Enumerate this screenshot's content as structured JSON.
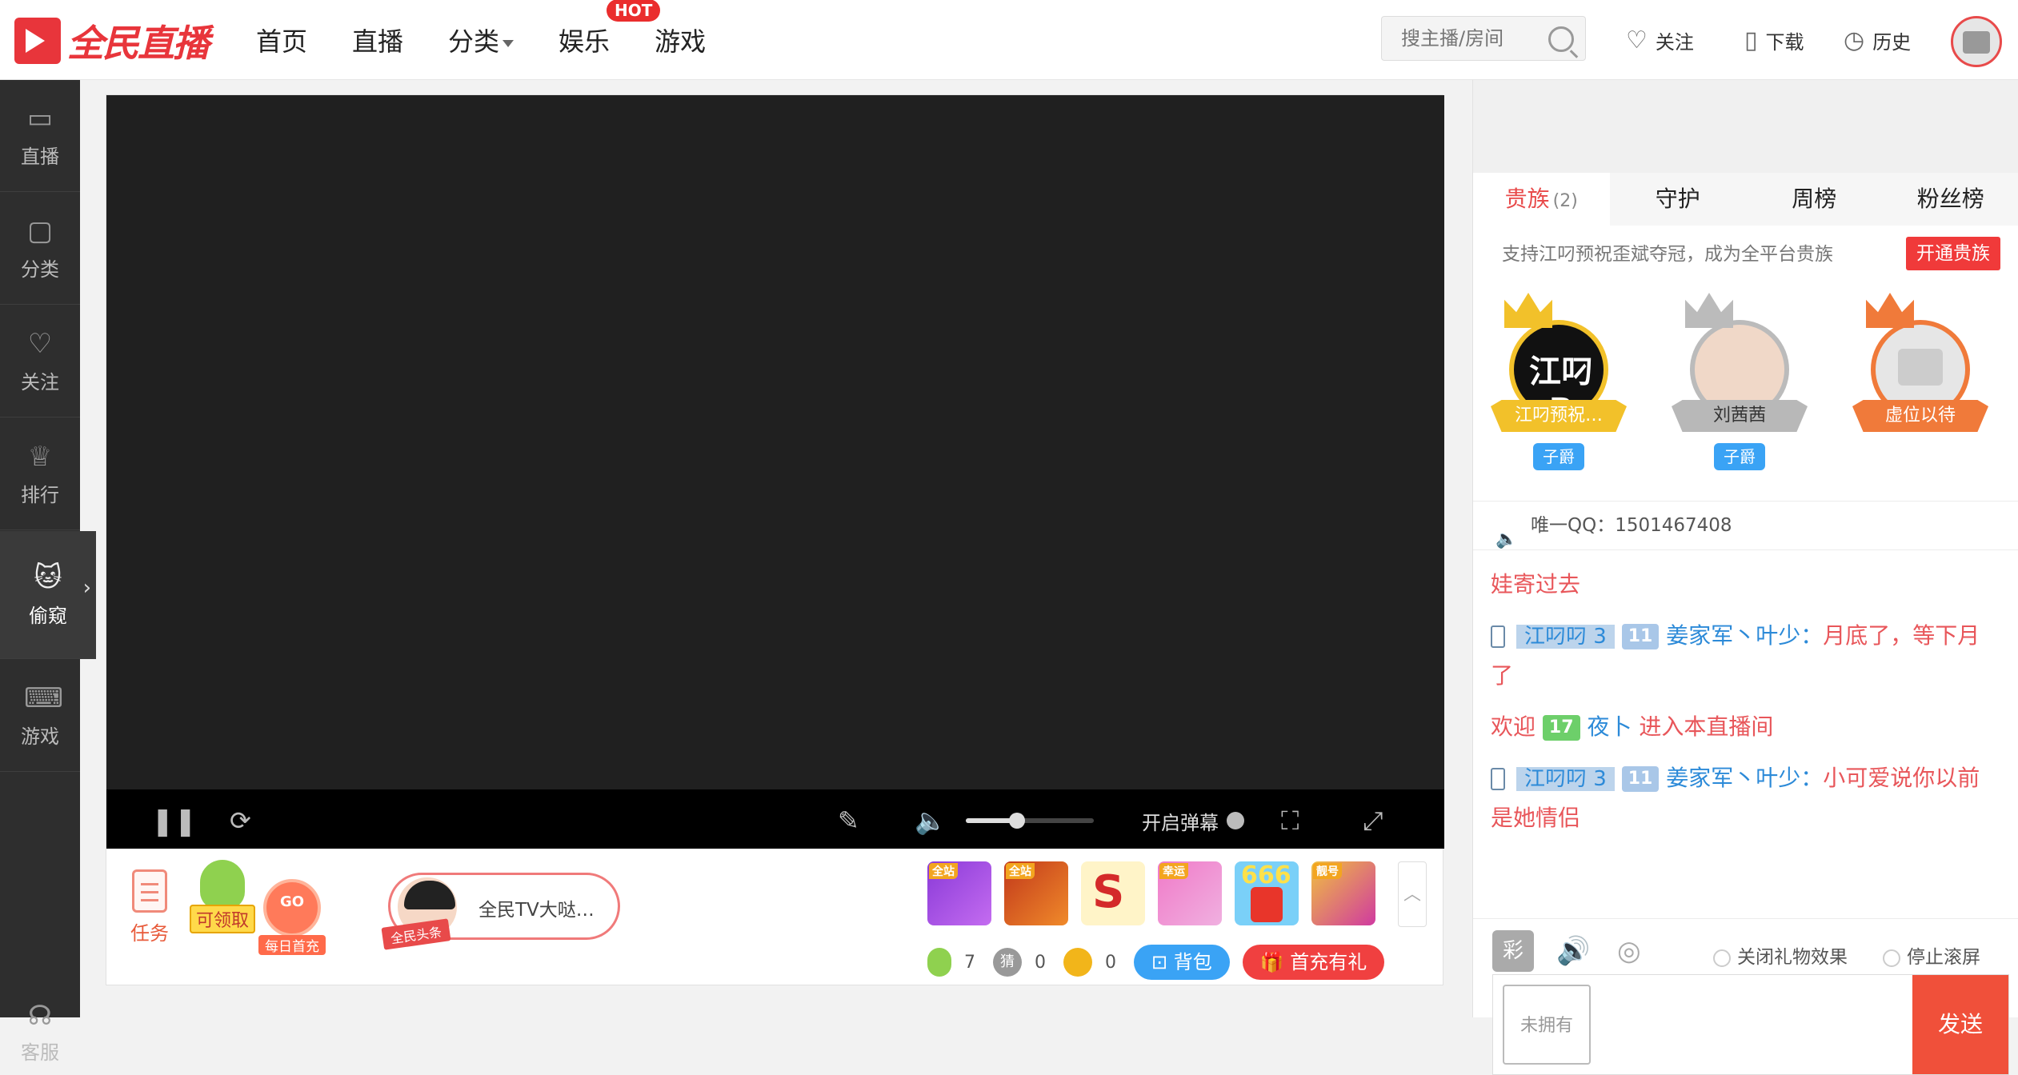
{
  "header": {
    "logo_text": "全民直播",
    "nav": [
      "首页",
      "直播",
      "分类",
      "娱乐",
      "游戏"
    ],
    "hot_badge": "HOT",
    "search_placeholder": "搜主播/房间",
    "follow": "关注",
    "download": "下载",
    "history": "历史"
  },
  "sidebar": {
    "items": [
      "直播",
      "分类",
      "关注",
      "排行",
      "偷窥",
      "游戏"
    ],
    "bottom": "客服"
  },
  "player": {
    "danmu_label": "开启弹幕",
    "volume_fraction": 0.4
  },
  "giftbar": {
    "task_label": "任务",
    "pear_label": "可领取",
    "daily_label": "每日首充",
    "headline_ribbon": "全民头条",
    "headline_text": "全民TV大哒…",
    "gift_tags": [
      "全站",
      "全站",
      "",
      "幸运",
      "",
      "靓号"
    ],
    "gift_666": "666",
    "wallet": {
      "pear": "7",
      "guess": "0",
      "coin": "0"
    },
    "bag_label": "背包",
    "recharge_label": "首充有礼",
    "guess_char": "猜"
  },
  "panel": {
    "tabs": [
      "贵族",
      "守护",
      "周榜",
      "粉丝榜"
    ],
    "noble_count": "(2)",
    "support_text": "支持江叼预祝歪斌夺冠，成为全平台贵族",
    "open_btn": "开通贵族",
    "nobles": [
      {
        "name": "江叼预祝…",
        "rank": "子爵",
        "avatar_text": "江叼B"
      },
      {
        "name": "刘茜茜",
        "rank": "子爵",
        "avatar_text": ""
      },
      {
        "name": "虚位以待",
        "rank": "",
        "avatar_text": ""
      }
    ],
    "notice": "唯一QQ：1501467408",
    "chat": {
      "m0_tail": "娃寄过去",
      "m1_user": "江叼叼",
      "m1_user_lvl": "3",
      "m1_fan_lvl": "11",
      "m1_name": "姜家军丶叶少",
      "m1_text": "月底了，等下月了",
      "m2_welcome": "欢迎",
      "m2_lvl": "17",
      "m2_name": "夜卜",
      "m2_text": "进入本直播间",
      "m3_user": "江叼叼",
      "m3_user_lvl": "3",
      "m3_fan_lvl": "11",
      "m3_name": "姜家军丶叶少",
      "m3_text": "小可爱说你以前是她情侣"
    },
    "cai_btn": "彩",
    "opt_gift": "关闭礼物效果",
    "opt_scroll": "停止滚屏",
    "unowned": "未拥有",
    "send": "发送"
  }
}
